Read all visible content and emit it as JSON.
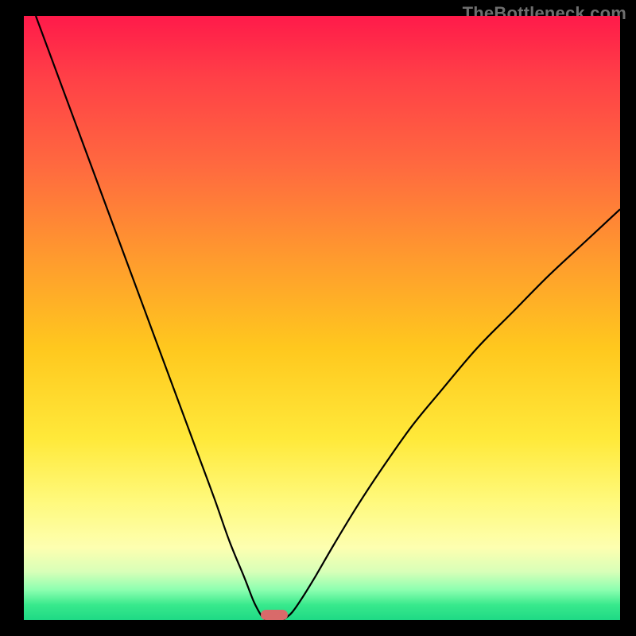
{
  "watermark": "TheBottleneck.com",
  "chart_data": {
    "type": "line",
    "title": "",
    "xlabel": "",
    "ylabel": "",
    "xlim": [
      0,
      100
    ],
    "ylim": [
      0,
      100
    ],
    "series": [
      {
        "name": "left-branch",
        "x": [
          2,
          5,
          8,
          11,
          14,
          17,
          20,
          23,
          26,
          29,
          32,
          34.5,
          37,
          38.5,
          39.6,
          40.2,
          40.6
        ],
        "y": [
          100,
          92,
          84,
          76,
          68,
          60,
          52,
          44,
          36,
          28,
          20,
          13,
          7,
          3.2,
          1.1,
          0.3,
          0
        ]
      },
      {
        "name": "right-branch",
        "x": [
          43.5,
          44,
          45,
          46.5,
          49,
          52,
          56,
          60,
          65,
          70,
          76,
          82,
          88,
          94,
          100
        ],
        "y": [
          0,
          0.4,
          1.3,
          3.4,
          7.4,
          12.5,
          19,
          25,
          32,
          38,
          45,
          51,
          57,
          62.5,
          68
        ]
      }
    ],
    "marker": {
      "x_center": 42,
      "width": 4.5,
      "height": 1.7
    },
    "background_gradient": {
      "top": "#ff1a4a",
      "mid_upper": "#ff9a2e",
      "mid": "#ffe93a",
      "mid_lower": "#fdffb0",
      "bottom": "#1ed985"
    }
  }
}
